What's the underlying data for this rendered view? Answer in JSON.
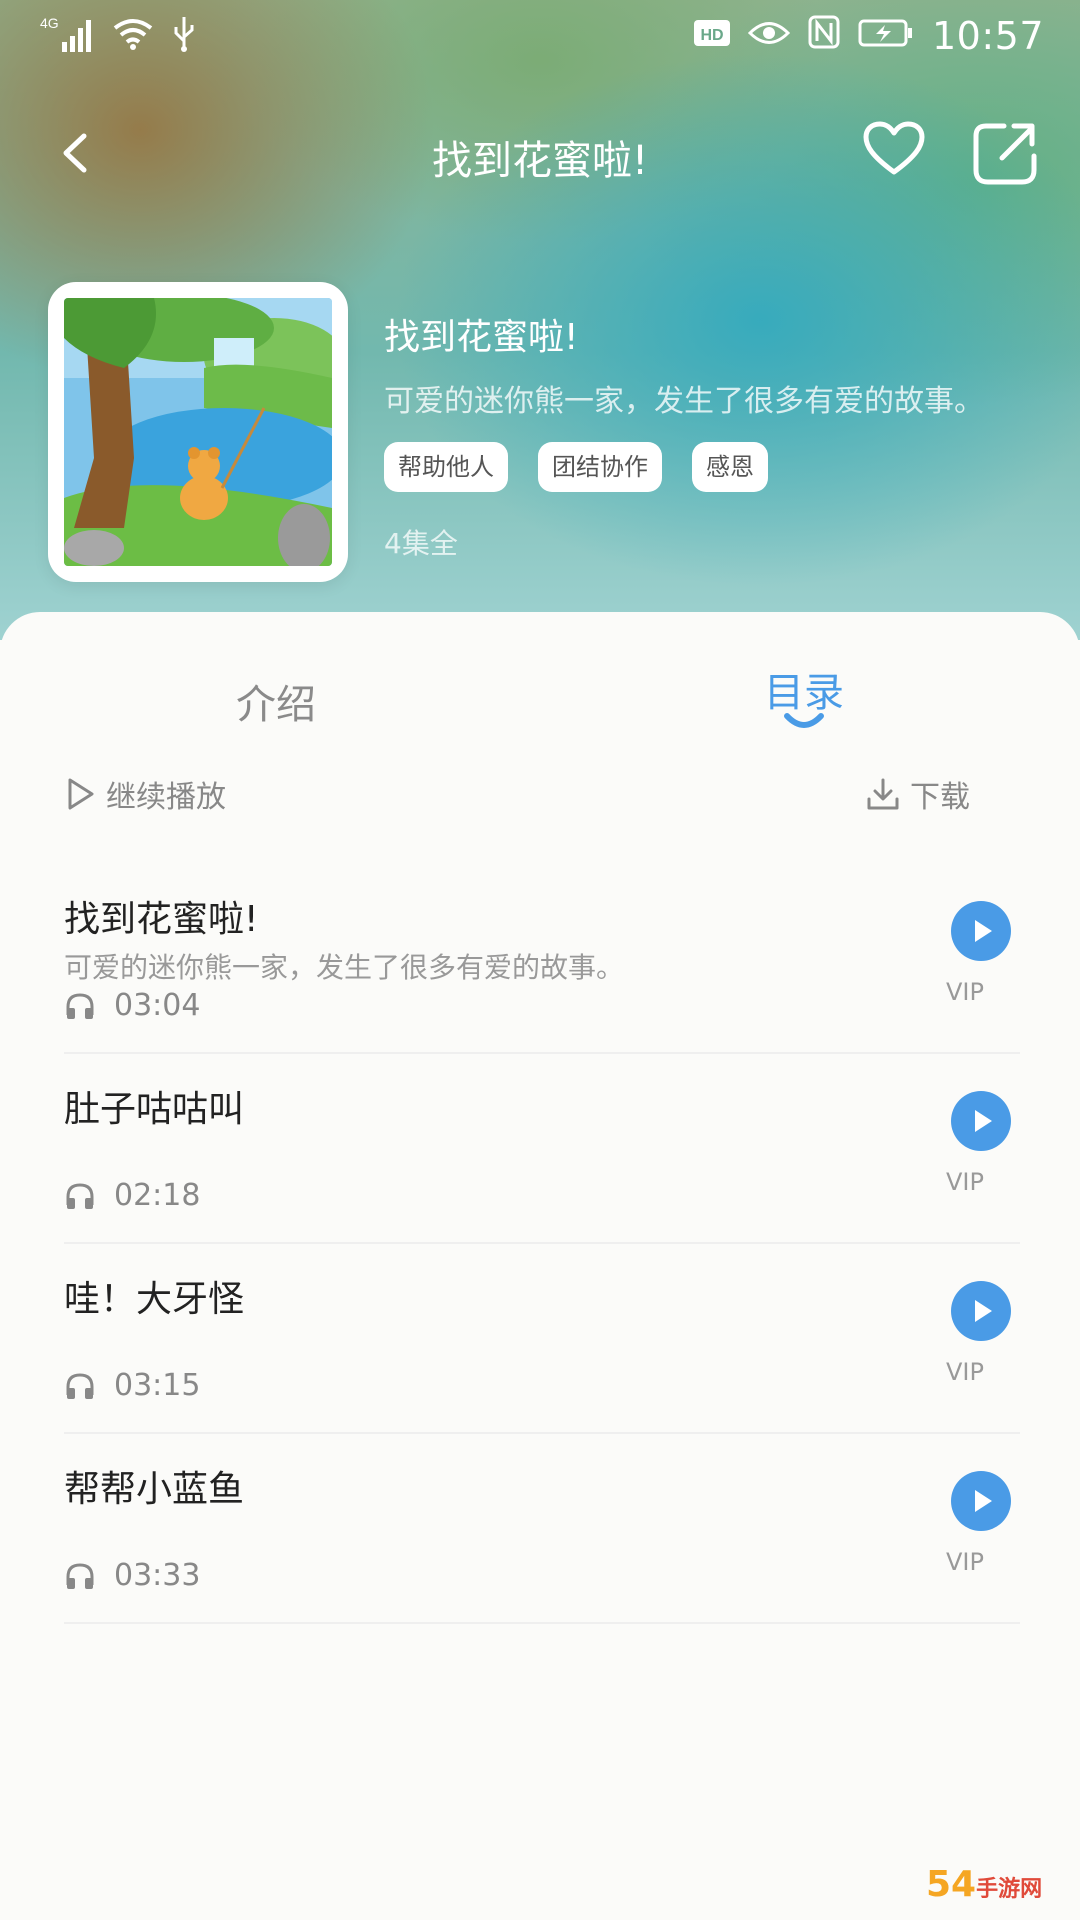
{
  "status_bar": {
    "network": "4G",
    "badge": "HD",
    "time": "10:57"
  },
  "header": {
    "title": "找到花蜜啦!",
    "icons": {
      "back": "chevron-left-icon",
      "favorite": "heart-icon",
      "share": "share-icon"
    }
  },
  "album": {
    "title": "找到花蜜啦!",
    "description": "可爱的迷你熊一家，发生了很多有爱的故事。",
    "tags": [
      "帮助他人",
      "团结协作",
      "感恩"
    ],
    "episode_count": "4集全"
  },
  "tabs": [
    {
      "label": "介绍",
      "active": false
    },
    {
      "label": "目录",
      "active": true
    }
  ],
  "actions": {
    "continue_label": "继续播放",
    "download_label": "下载"
  },
  "episodes": [
    {
      "title": "找到花蜜啦!",
      "description": "可爱的迷你熊一家，发生了很多有爱的故事。",
      "duration": "03:04",
      "badge": "VIP"
    },
    {
      "title": "肚子咕咕叫",
      "description": "",
      "duration": "02:18",
      "badge": "VIP"
    },
    {
      "title": "哇！大牙怪",
      "description": "",
      "duration": "03:15",
      "badge": "VIP"
    },
    {
      "title": "帮帮小蓝鱼",
      "description": "",
      "duration": "03:33",
      "badge": "VIP"
    }
  ],
  "watermark": {
    "main": "54",
    "sub": "手游网"
  },
  "colors": {
    "accent": "#4a9be6",
    "play_button": "#4a9be6",
    "text_primary": "#222222",
    "text_secondary": "#999999"
  }
}
